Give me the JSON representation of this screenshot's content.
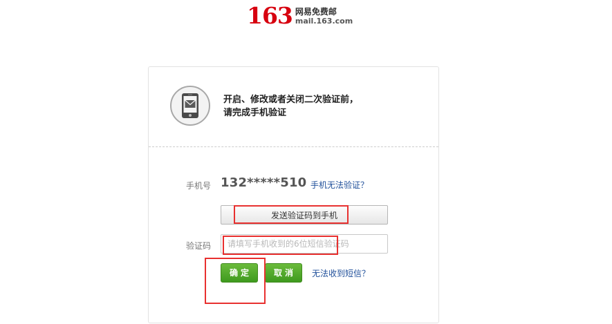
{
  "header": {
    "logo_number": "163",
    "logo_cn": "网易免费邮",
    "logo_domain": "mail.163.com"
  },
  "intro": {
    "line1": "开启、修改或者关闭二次验证前，",
    "line2": "请完成手机验证"
  },
  "form": {
    "phone_label": "手机号",
    "phone_value": "132*****510",
    "phone_help_link": "手机无法验证？",
    "send_code_button": "发送验证码到手机",
    "code_label": "验证码",
    "code_placeholder": "请填写手机收到的6位短信验证码",
    "code_value": "",
    "confirm_button": "确定",
    "cancel_button": "取消",
    "sms_help_link": "无法收到短信？"
  },
  "colors": {
    "brand_red": "#d7000f",
    "button_green": "#4ea62a",
    "link_blue": "#1f4f9a",
    "annotation_red": "#e8302f"
  },
  "icons": {
    "intro_icon": "phone-message-icon"
  }
}
